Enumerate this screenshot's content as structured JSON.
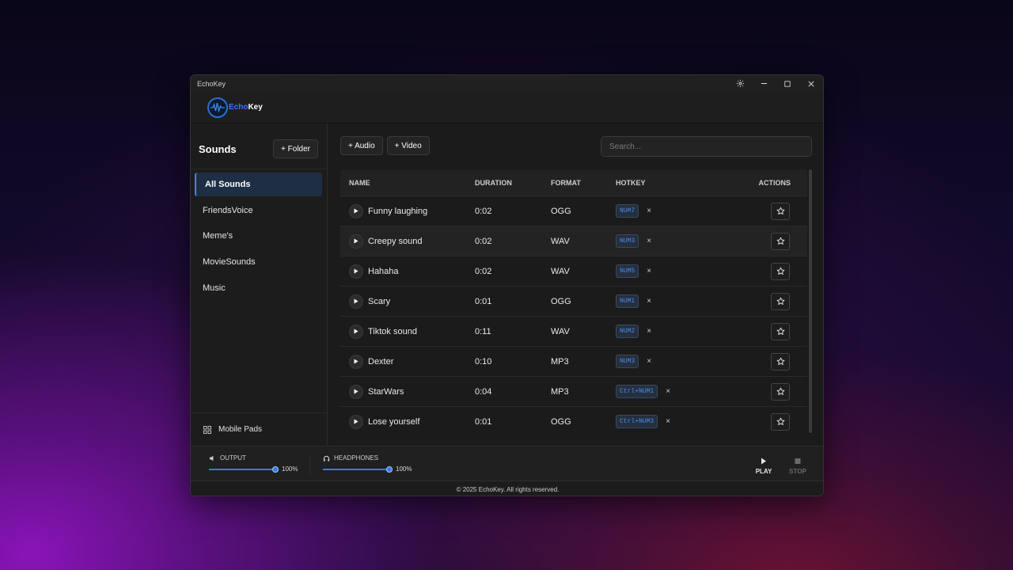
{
  "window": {
    "title": "EchoKey"
  },
  "logo": {
    "part1": "Echo",
    "part2": "Key"
  },
  "sidebar": {
    "title": "Sounds",
    "add_folder_label": "+ Folder",
    "items": [
      {
        "label": "All Sounds",
        "active": true
      },
      {
        "label": "FriendsVoice"
      },
      {
        "label": "Meme's"
      },
      {
        "label": "MovieSounds"
      },
      {
        "label": "Music"
      }
    ],
    "mobile_pads_label": "Mobile Pads"
  },
  "toolbar": {
    "add_audio_label": "+ Audio",
    "add_video_label": "+ Video"
  },
  "search": {
    "placeholder": "Search..."
  },
  "table": {
    "headers": {
      "name": "NAME",
      "duration": "DURATION",
      "format": "FORMAT",
      "hotkey": "HOTKEY",
      "actions": "ACTIONS"
    },
    "rows": [
      {
        "name": "Funny laughing",
        "duration": "0:02",
        "format": "OGG",
        "hotkey": "NUM7"
      },
      {
        "name": "Creepy sound",
        "duration": "0:02",
        "format": "WAV",
        "hotkey": "NUM3"
      },
      {
        "name": "Hahaha",
        "duration": "0:02",
        "format": "WAV",
        "hotkey": "NUM5"
      },
      {
        "name": "Scary",
        "duration": "0:01",
        "format": "OGG",
        "hotkey": "NUM1"
      },
      {
        "name": "Tiktok sound",
        "duration": "0:11",
        "format": "WAV",
        "hotkey": "NUM2"
      },
      {
        "name": "Dexter",
        "duration": "0:10",
        "format": "MP3",
        "hotkey": "NUM3"
      },
      {
        "name": "StarWars",
        "duration": "0:04",
        "format": "MP3",
        "hotkey": "Ctrl+NUM1"
      },
      {
        "name": "Lose yourself",
        "duration": "0:01",
        "format": "OGG",
        "hotkey": "Ctrl+NUM3"
      }
    ],
    "remove_hotkey_symbol": "×"
  },
  "audio": {
    "output_label": "OUTPUT",
    "output_level": "100%",
    "headphones_label": "HEADPHONES",
    "headphones_level": "100%",
    "play_label": "PLAY",
    "stop_label": "STOP"
  },
  "footer": {
    "text": "© 2025 EchoKey. All rights reserved."
  },
  "colors": {
    "accent": "#2f7df0",
    "hotkey_text": "#4a8cf0",
    "active_bg": "#1e2e44"
  },
  "icons": [
    "gear-icon",
    "minimize-icon",
    "maximize-icon",
    "close-icon",
    "play-icon",
    "star-icon",
    "speaker-icon",
    "headphones-icon",
    "grid-icon",
    "stop-icon"
  ]
}
